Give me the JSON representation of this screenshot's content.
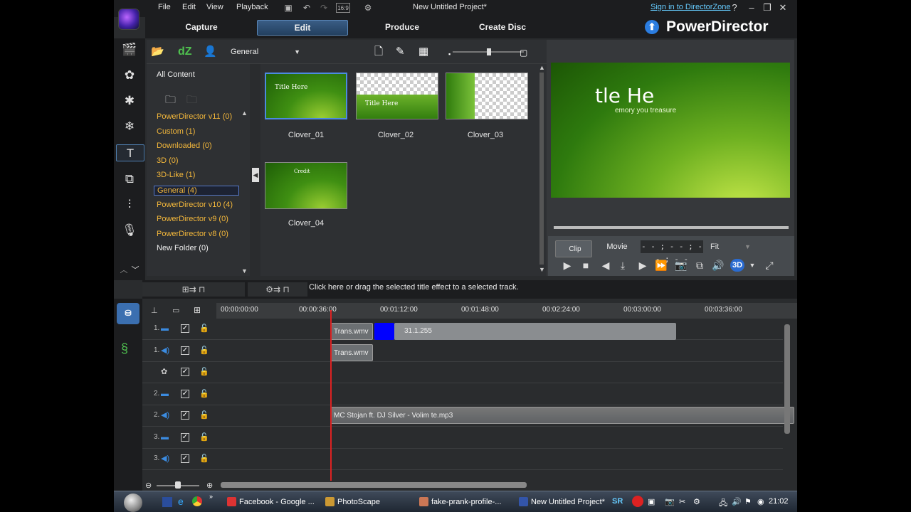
{
  "window": {
    "title": "New Untitled Project*",
    "sign_in": "Sign in to DirectorZone",
    "menu": [
      "File",
      "Edit",
      "View",
      "Playback"
    ]
  },
  "modes": {
    "tabs": [
      {
        "label": "Capture",
        "active": false
      },
      {
        "label": "Edit",
        "active": true
      },
      {
        "label": "Produce",
        "active": false
      },
      {
        "label": "Create Disc",
        "active": false
      }
    ],
    "brand": "PowerDirector"
  },
  "library": {
    "category": "General",
    "all_content": "All Content",
    "folders": [
      {
        "label": "PowerDirector v11  (0)"
      },
      {
        "label": "Custom  (1)"
      },
      {
        "label": "Downloaded  (0)"
      },
      {
        "label": "3D  (0)"
      },
      {
        "label": "3D-Like  (1)"
      },
      {
        "label": "General  (4)",
        "selected": true
      },
      {
        "label": "PowerDirector v10  (4)"
      },
      {
        "label": "PowerDirector v9  (0)"
      },
      {
        "label": "PowerDirector v8  (0)"
      },
      {
        "label": "New Folder  (0)",
        "plain": true
      }
    ],
    "thumbnails": [
      {
        "name": "Clover_01",
        "caption": "Title Here",
        "style": "green",
        "selected": true
      },
      {
        "name": "Clover_02",
        "caption": "Title Here",
        "style": "checker-top"
      },
      {
        "name": "Clover_03",
        "caption": "",
        "style": "checker-right"
      },
      {
        "name": "Clover_04",
        "caption": "Credit",
        "style": "green"
      }
    ]
  },
  "preview": {
    "title_text": "tle He",
    "subtitle_text": "emory you treasure",
    "clip_label": "Clip",
    "movie_label": "Movie",
    "timecode": "- - ; - - ; - - ; - -",
    "fit": "Fit",
    "mode_3d": "3D"
  },
  "hint": "Click here or drag the selected title effect to a selected track.",
  "timeline": {
    "ruler": [
      "00:00:00:00",
      "00:00:36:00",
      "00:01:12:00",
      "00:01:48:00",
      "00:02:24:00",
      "00:03:00:00",
      "00:03:36:00"
    ],
    "tracks": [
      {
        "num": "1.",
        "type": "video"
      },
      {
        "num": "1.",
        "type": "audio"
      },
      {
        "num": "",
        "type": "fx"
      },
      {
        "num": "2.",
        "type": "video"
      },
      {
        "num": "2.",
        "type": "audio"
      },
      {
        "num": "3.",
        "type": "video"
      },
      {
        "num": "3.",
        "type": "audio"
      }
    ],
    "clips": {
      "video1": "Trans.wmv",
      "color": "31.1.255",
      "audio1": "Trans.wmv",
      "audio2": "MC Stojan ft. DJ Silver - Volim te.mp3"
    }
  },
  "taskbar": {
    "tasks": [
      {
        "label": "Facebook - Google ...",
        "color": "#d33"
      },
      {
        "label": "PhotoScape",
        "color": "#c93"
      },
      {
        "label": "fake-prank-profile-...",
        "color": "#c75"
      },
      {
        "label": "New Untitled Project*",
        "color": "#35a"
      }
    ],
    "sr": "SR",
    "clock": "21:02"
  },
  "colors": {
    "accent": "#4c8ae0",
    "folder_text": "#f3b73b",
    "playhead": "#dd2222",
    "link": "#66ccff"
  }
}
